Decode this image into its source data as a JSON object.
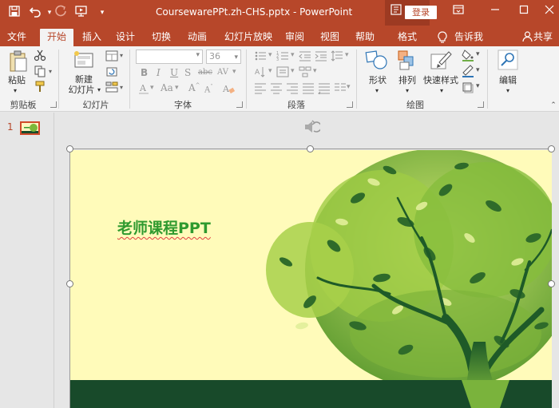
{
  "titlebar": {
    "title": "CoursewarePPt.zh-CHS.pptx  -  PowerPoint",
    "login": "登录",
    "qat_icons": [
      "save-icon",
      "undo-icon",
      "redo-icon",
      "slideshow-from-beginning-icon",
      "customize-qat-icon"
    ],
    "window_controls": [
      "ribbon-display-options-icon",
      "minimize-icon",
      "restore-icon",
      "close-icon"
    ]
  },
  "tabs": {
    "file": "文件",
    "home": "开始",
    "insert": "插入",
    "design": "设计",
    "transitions": "切换",
    "animations": "动画",
    "slideshow": "幻灯片放映",
    "review": "审阅",
    "view": "视图",
    "help": "帮助",
    "format": "格式",
    "tellme": "告诉我",
    "share": "共享"
  },
  "ribbon": {
    "clipboard": {
      "label": "剪贴板",
      "paste": "粘贴"
    },
    "slides": {
      "label": "幻灯片",
      "new_slide_line1": "新建",
      "new_slide_line2": "幻灯片"
    },
    "font": {
      "label": "字体",
      "size": "36"
    },
    "paragraph": {
      "label": "段落"
    },
    "drawing": {
      "label": "绘图",
      "shapes": "形状",
      "arrange": "排列",
      "quick_styles": "快速样式"
    },
    "editing": {
      "label": "编辑"
    }
  },
  "thumbnails": {
    "slide_number": "1"
  },
  "slide": {
    "title": "老师课程PPT"
  },
  "colors": {
    "accent": "#b7472a",
    "ribbon_bg": "#f3f3f3",
    "slide_bg": "#fffbba",
    "slide_title": "#2f9a2f",
    "tree_dark": "#1e5a28",
    "tree_leaf": "#7cb83a"
  }
}
